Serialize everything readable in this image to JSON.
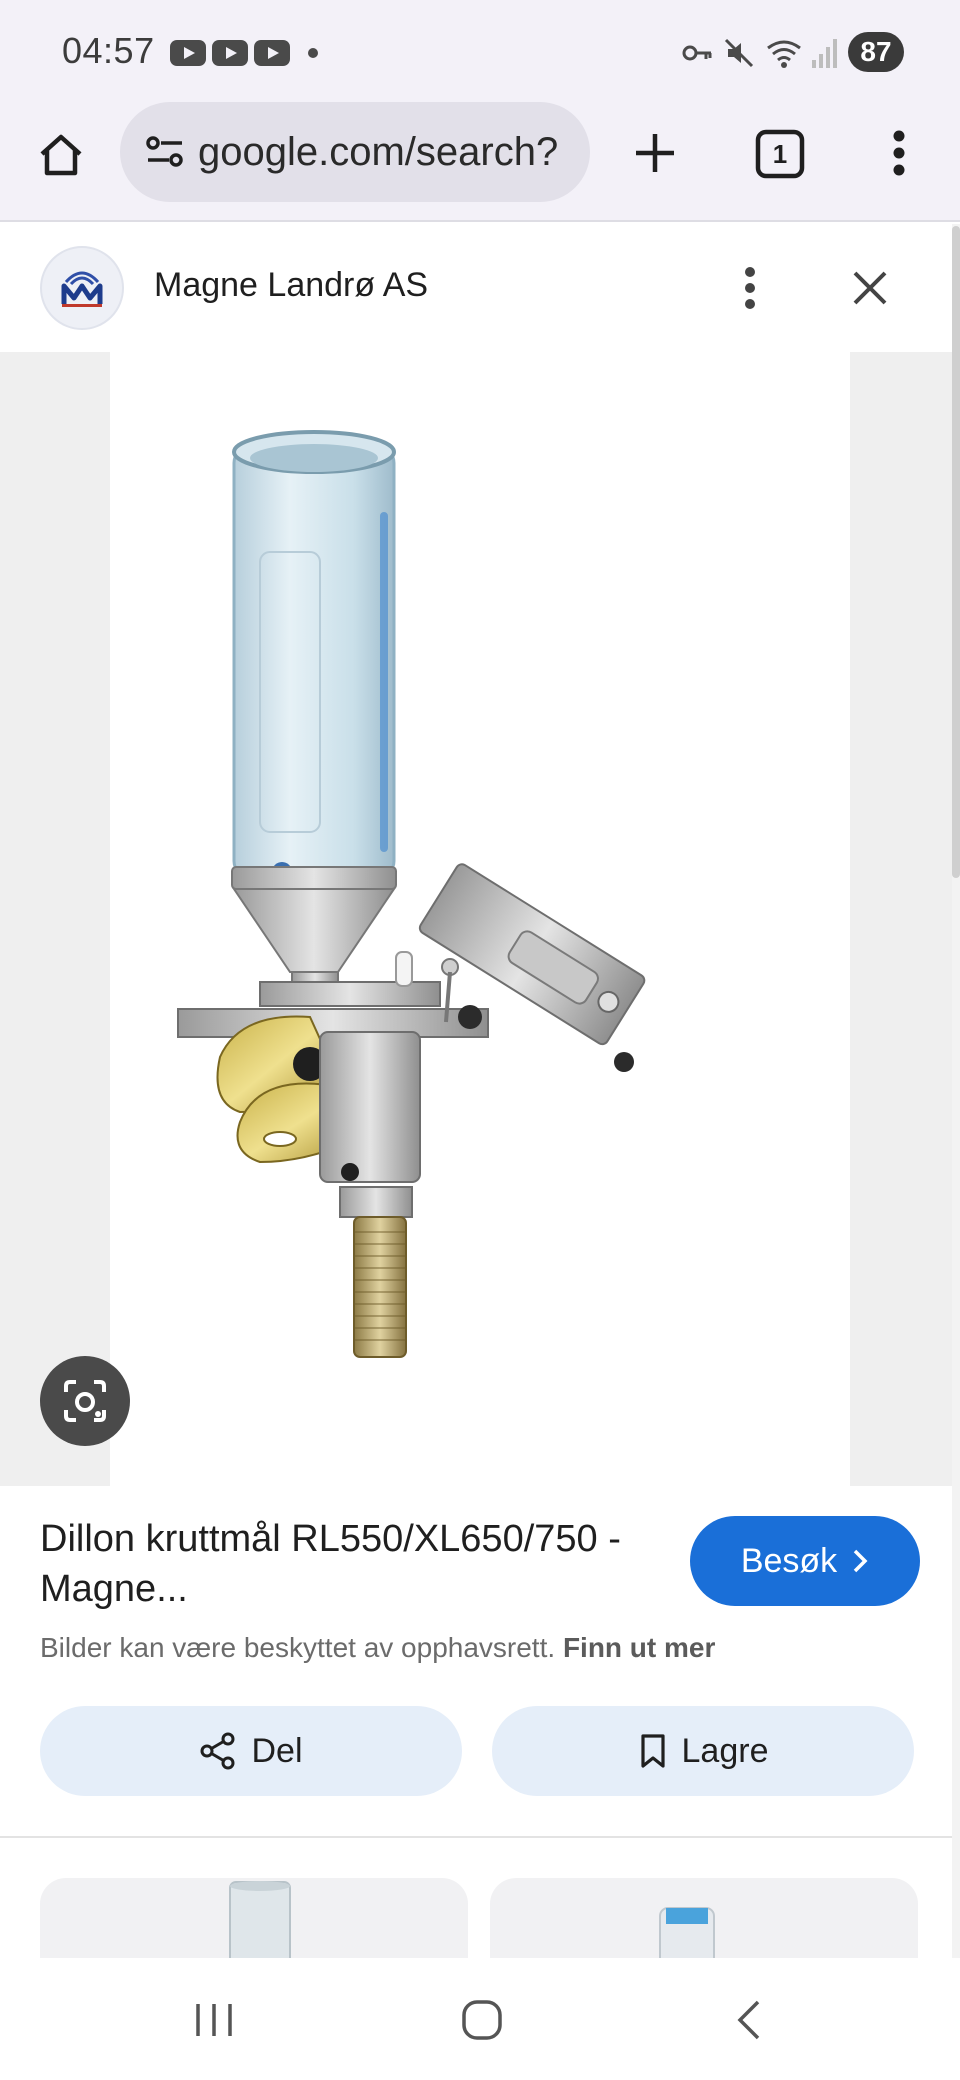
{
  "status_bar": {
    "time": "04:57",
    "battery": "87",
    "icons": [
      "youtube-icon",
      "youtube-icon",
      "youtube-icon",
      "notification-dot-icon",
      "vpn-key-icon",
      "mute-icon",
      "wifi-icon",
      "signal-icon"
    ]
  },
  "browser": {
    "url": "google.com/search?",
    "tab_count": "1",
    "icons": [
      "home-icon",
      "site-settings-icon",
      "plus-icon",
      "tab-switcher-icon",
      "more-vert-icon"
    ]
  },
  "site": {
    "name": "Magne Landrø AS",
    "icons": [
      "site-logo-icon",
      "more-vert-icon",
      "close-icon"
    ]
  },
  "result": {
    "title": "Dillon kruttmål RL550/XL650/750 - Magne...",
    "visit_label": "Besøk",
    "copyright_text": "Bilder kan være beskyttet av opphavsrett.",
    "learn_more": "Finn ut mer",
    "share_label": "Del",
    "save_label": "Lagre"
  },
  "colors": {
    "chrome_bg": "#f3f1f8",
    "accent": "#1a6fd8",
    "pill_bg": "#e5eef9",
    "viewer_bg": "#efefef"
  },
  "navigation": {
    "icons": [
      "recent-apps-icon",
      "home-circle-icon",
      "back-icon"
    ]
  }
}
